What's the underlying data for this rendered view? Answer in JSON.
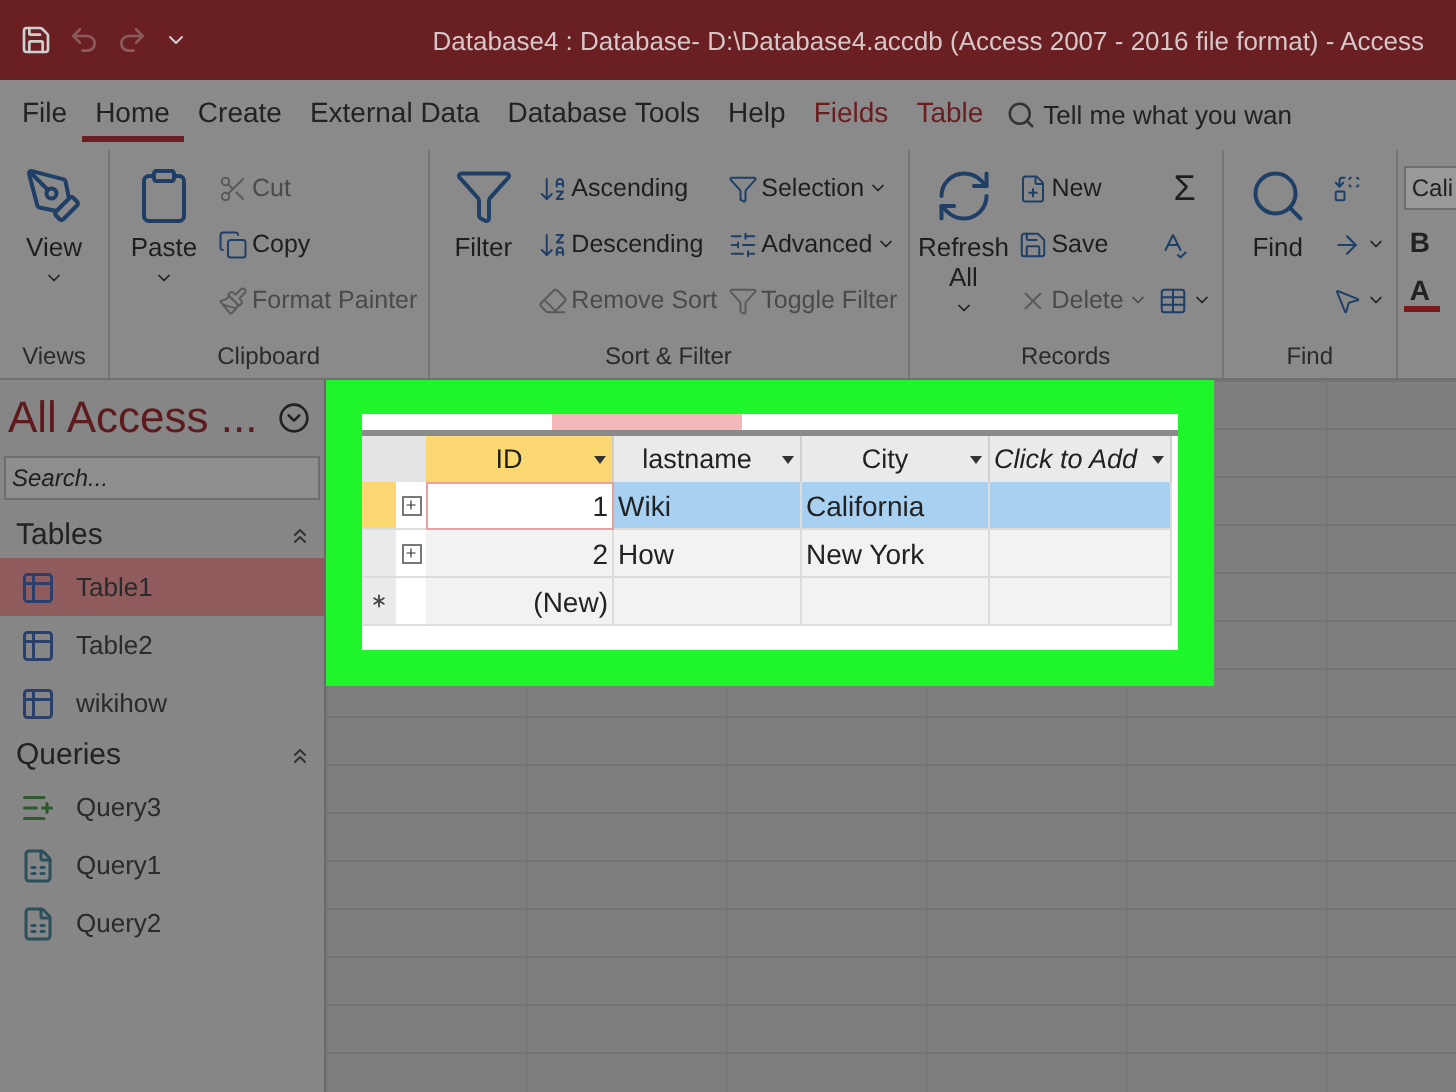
{
  "title_bar": {
    "title": "Database4 : Database- D:\\Database4.accdb (Access 2007 - 2016 file format)  -  Access"
  },
  "tabs": [
    {
      "label": "File",
      "selected": false,
      "kind": "normal"
    },
    {
      "label": "Home",
      "selected": true,
      "kind": "normal"
    },
    {
      "label": "Create",
      "selected": false,
      "kind": "normal"
    },
    {
      "label": "External Data",
      "selected": false,
      "kind": "normal"
    },
    {
      "label": "Database Tools",
      "selected": false,
      "kind": "normal"
    },
    {
      "label": "Help",
      "selected": false,
      "kind": "normal"
    },
    {
      "label": "Fields",
      "selected": false,
      "kind": "contextual"
    },
    {
      "label": "Table",
      "selected": false,
      "kind": "contextual"
    }
  ],
  "tell_me": {
    "placeholder": "Tell me what you wan"
  },
  "ribbon_groups": [
    {
      "label": "Views",
      "columns": [
        [
          {
            "label": "View",
            "kind": "large",
            "disabled": false,
            "dropdown": true
          }
        ]
      ]
    },
    {
      "label": "Clipboard",
      "columns": [
        [
          {
            "label": "Paste",
            "kind": "large",
            "disabled": false,
            "dropdown": true
          }
        ],
        [
          {
            "label": "Cut",
            "kind": "small",
            "disabled": true
          },
          {
            "label": "Copy",
            "kind": "small",
            "disabled": false
          },
          {
            "label": "Format Painter",
            "kind": "small",
            "disabled": true
          }
        ]
      ]
    },
    {
      "label": "Sort & Filter",
      "columns": [
        [
          {
            "label": "Filter",
            "kind": "large",
            "disabled": false
          }
        ],
        [
          {
            "label": "Ascending",
            "kind": "small",
            "disabled": false
          },
          {
            "label": "Descending",
            "kind": "small",
            "disabled": false
          },
          {
            "label": "Remove Sort",
            "kind": "small",
            "disabled": true
          }
        ],
        [
          {
            "label": "Selection",
            "kind": "small",
            "disabled": false,
            "dropdown": true
          },
          {
            "label": "Advanced",
            "kind": "small",
            "disabled": false,
            "dropdown": true
          },
          {
            "label": "Toggle Filter",
            "kind": "small",
            "disabled": true
          }
        ]
      ]
    },
    {
      "label": "Records",
      "columns": [
        [
          {
            "label": "Refresh All",
            "kind": "large",
            "disabled": false,
            "dropdown": true
          }
        ],
        [
          {
            "label": "New",
            "kind": "small",
            "disabled": false
          },
          {
            "label": "Save",
            "kind": "small",
            "disabled": false
          },
          {
            "label": "Delete",
            "kind": "small",
            "disabled": true,
            "dropdown": true
          }
        ],
        [
          {
            "label": "Σ",
            "kind": "glyph",
            "disabled": false
          },
          {
            "kind": "icon",
            "disabled": false
          },
          {
            "kind": "icon",
            "disabled": false,
            "dropdown": true
          }
        ]
      ]
    },
    {
      "label": "Find",
      "columns": [
        [
          {
            "label": "Find",
            "kind": "large",
            "disabled": false
          }
        ],
        [
          {
            "kind": "icon",
            "disabled": false
          },
          {
            "kind": "icon",
            "disabled": false,
            "dropdown": true
          },
          {
            "kind": "icon",
            "disabled": false,
            "dropdown": true
          }
        ]
      ]
    }
  ],
  "font_group": {
    "font_name": "Cali",
    "bold": "B",
    "font_color_label": "A"
  },
  "nav_pane": {
    "title": "All Access ...",
    "search": {
      "placeholder": "Search..."
    },
    "sections": [
      {
        "title": "Tables",
        "items": [
          {
            "label": "Table1",
            "selected": true,
            "kind": "table"
          },
          {
            "label": "Table2",
            "selected": false,
            "kind": "table"
          },
          {
            "label": "wikihow",
            "selected": false,
            "kind": "table"
          }
        ]
      },
      {
        "title": "Queries",
        "items": [
          {
            "label": "Query3",
            "selected": false,
            "kind": "append"
          },
          {
            "label": "Query1",
            "selected": false,
            "kind": "query"
          },
          {
            "label": "Query2",
            "selected": false,
            "kind": "query"
          }
        ]
      }
    ]
  },
  "datasheet": {
    "columns": [
      {
        "label": "ID",
        "kind": "field",
        "selected": true
      },
      {
        "label": "lastname",
        "kind": "field",
        "selected": false
      },
      {
        "label": "City",
        "kind": "field",
        "selected": false
      },
      {
        "label": "Click to Add",
        "kind": "add",
        "selected": false
      }
    ],
    "rows": [
      {
        "kind": "record",
        "selected": true,
        "cells": [
          "1",
          "Wiki",
          "California",
          ""
        ]
      },
      {
        "kind": "record",
        "selected": false,
        "cells": [
          "2",
          "How",
          "New York",
          ""
        ]
      },
      {
        "kind": "new",
        "selected": false,
        "cells": [
          "(New)",
          "",
          "",
          ""
        ]
      }
    ]
  }
}
